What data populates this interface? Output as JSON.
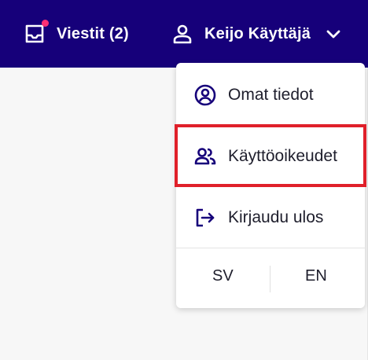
{
  "header": {
    "messages_label": "Viestit (2)",
    "messages_icon": "inbox-icon",
    "user_name": "Keijo Käyttäjä",
    "user_icon": "user-icon",
    "chevron_icon": "chevron-down-icon"
  },
  "dropdown": {
    "items": [
      {
        "label": "Omat tiedot",
        "icon": "user-circle-icon"
      },
      {
        "label": "Käyttöoikeudet",
        "icon": "users-icon"
      },
      {
        "label": "Kirjaudu ulos",
        "icon": "logout-icon"
      }
    ],
    "languages": [
      "SV",
      "EN"
    ]
  },
  "colors": {
    "header_bg": "#16007a",
    "header_text": "#ffffff",
    "notification_dot": "#ff2f74",
    "icon_color": "#16007a",
    "highlight": "#e0202a",
    "page_bg": "#f7f7f7"
  }
}
